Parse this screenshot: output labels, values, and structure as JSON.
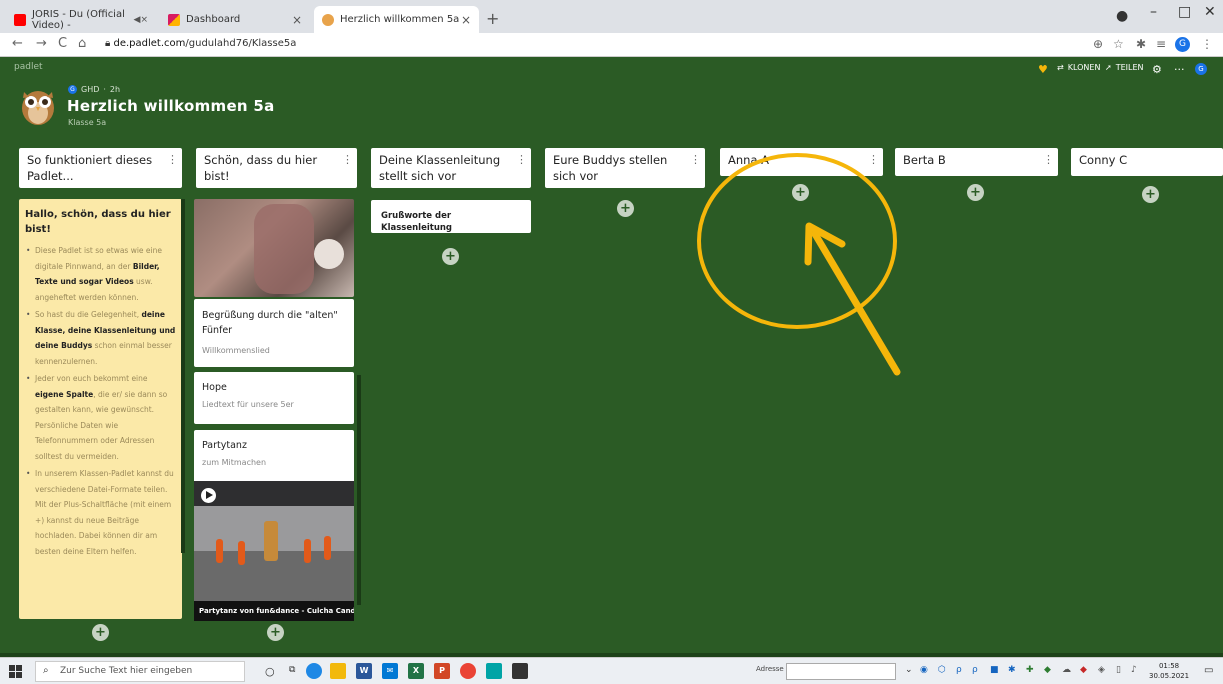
{
  "browser": {
    "tabs": [
      {
        "label": "JORIS - Du (Official Video) - ",
        "icon": "youtube-icon",
        "color": "#ff0000"
      },
      {
        "label": "Dashboard",
        "icon": "dashboard-icon",
        "color": "#d81b60"
      },
      {
        "label": "Herzlich willkommen 5a",
        "icon": "padlet-owl-icon",
        "color": "#e8a34b"
      }
    ],
    "new_tab": "+",
    "url_host": "de.padlet.com",
    "url_path": "/gudulahd76/Klasse5a",
    "profile_initial": "G"
  },
  "padlet": {
    "brand": "padlet",
    "actions": {
      "clone": "KLONEN",
      "share": "TEILEN"
    },
    "author": "GHD",
    "author_initial": "G",
    "age": "2h",
    "title": "Herzlich willkommen 5a",
    "subtitle": "Klasse 5a",
    "background": "#2b5b25",
    "columns": [
      {
        "title": "So funktioniert dieses Padlet..."
      },
      {
        "title": "Schön, dass du hier bist!"
      },
      {
        "title": "Deine Klassenleitung stellt sich vor"
      },
      {
        "title": "Eure Buddys stellen sich vor"
      },
      {
        "title": "Anna A"
      },
      {
        "title": "Berta B"
      },
      {
        "title": "Conny C"
      }
    ],
    "note": {
      "heading": "Hallo, schön, dass du hier bist!",
      "b1_a": "Diese Padlet ist so etwas wie eine digitale Pinnwand, an der ",
      "b1_b": "Bilder, Texte und sogar Videos",
      "b1_c": " usw. angeheftet werden können.",
      "b2_a": "So hast du die Gelegenheit, ",
      "b2_b": "deine Klasse, deine Klassenleitung und deine Buddys",
      "b2_c": " schon einmal besser kennenzulernen.",
      "b3_a": "Jeder von euch bekommt eine ",
      "b3_b": "eigene Spalte",
      "b3_c": ", die er/ sie dann so gestalten kann, wie gewünscht. Persönliche Daten wie Telefonnummern oder Adressen solltest du vermeiden.",
      "b4": "In unserem Klassen-Padlet kannst du verschiedene Datei-Formate teilen. Mit der Plus-Schaltfläche (mit einem +) kannst du neue Beiträge hochladen. Dabei können dir am besten deine Eltern helfen."
    },
    "cards": {
      "greeting_title": "Grußworte der Klassenleitung",
      "welcome_title": "Begrüßung durch die \"alten\" Fünfer",
      "welcome_sub": "Willkommenslied",
      "hope_title": "Hope",
      "hope_sub": "Liedtext für unsere 5er",
      "party_title": "Partytanz",
      "party_sub": "zum Mitmachen",
      "video_title": "Partytanz von fun&dance - Culcha Cand..."
    },
    "plus": "+",
    "annotation_color": "#f5b60a"
  },
  "taskbar": {
    "search_placeholder": "Zur Suche Text hier eingeben",
    "address_label": "Adresse",
    "time": "01:58",
    "date": "30.05.2021"
  }
}
